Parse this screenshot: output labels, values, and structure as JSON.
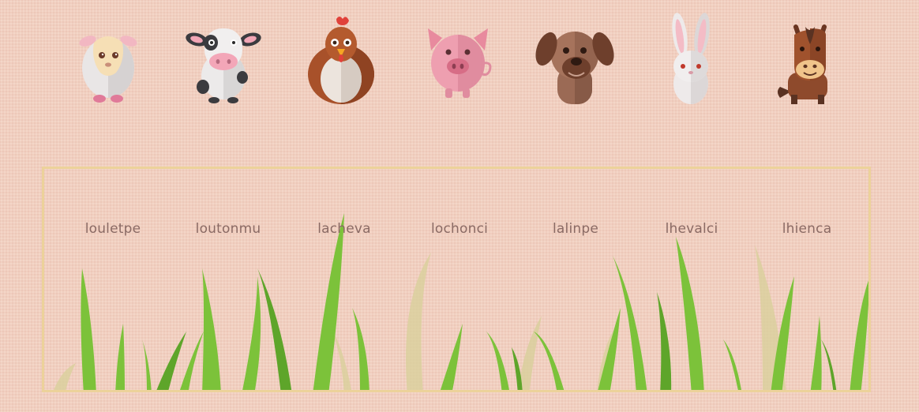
{
  "animals": [
    {
      "name": "sheep",
      "icon": "sheep-icon"
    },
    {
      "name": "cow",
      "icon": "cow-icon"
    },
    {
      "name": "hen",
      "icon": "hen-icon"
    },
    {
      "name": "pig",
      "icon": "pig-icon"
    },
    {
      "name": "dog",
      "icon": "dog-icon"
    },
    {
      "name": "rabbit",
      "icon": "rabbit-icon"
    },
    {
      "name": "horse",
      "icon": "horse-icon"
    }
  ],
  "slots": [
    {
      "label": "louletpe"
    },
    {
      "label": "loutonmu"
    },
    {
      "label": "lacheva"
    },
    {
      "label": "lochonci"
    },
    {
      "label": "lalinpe"
    },
    {
      "label": "lhevalci"
    },
    {
      "label": "lhienca"
    }
  ],
  "colors": {
    "background": "#f1cfc0",
    "board_border": "#ecd29a",
    "label_text": "#8a6a64",
    "grass_bright": "#7cc23a",
    "grass_dark": "#5ea52a",
    "grass_faded": "#d9cf9b"
  }
}
